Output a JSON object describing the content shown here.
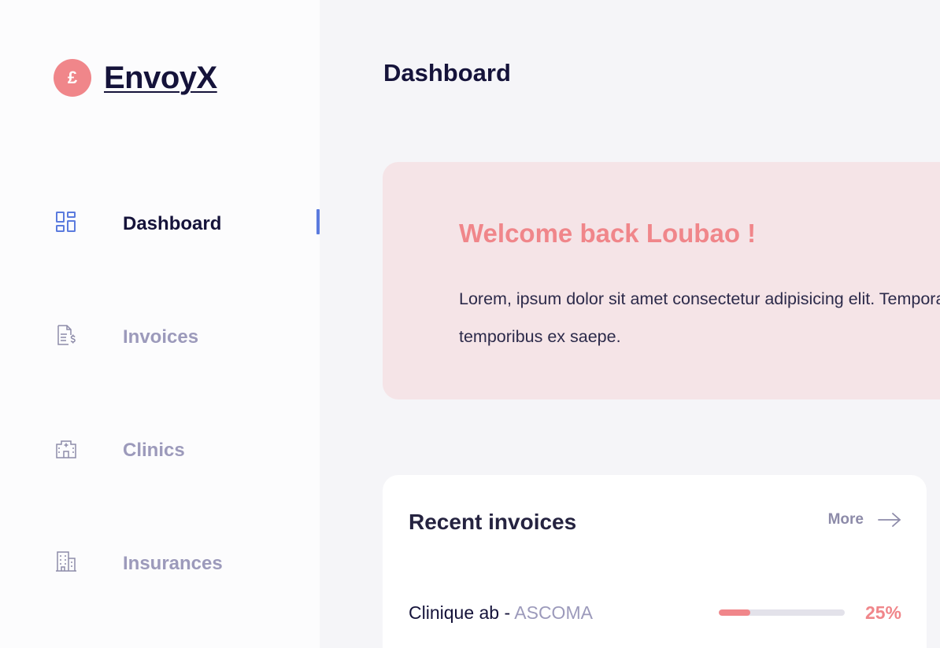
{
  "brand": {
    "logo_symbol": "£",
    "name": "EnvoyX"
  },
  "colors": {
    "accent": "#f0868a",
    "active_indicator": "#5b7bde",
    "text_dark": "#15133a",
    "text_muted": "#9c9abb"
  },
  "sidebar": {
    "items": [
      {
        "label": "Dashboard",
        "icon": "dashboard-grid-icon",
        "active": true
      },
      {
        "label": "Invoices",
        "icon": "invoice-dollar-icon",
        "active": false
      },
      {
        "label": "Clinics",
        "icon": "hospital-icon",
        "active": false
      },
      {
        "label": "Insurances",
        "icon": "building-icon",
        "active": false
      }
    ]
  },
  "header": {
    "title": "Dashboard"
  },
  "welcome": {
    "title": "Welcome back Loubao !",
    "text": "Lorem, ipsum dolor sit amet consectetur adipisicing elit. Tempora temporibus ex saepe."
  },
  "recent_invoices": {
    "title": "Recent invoices",
    "more_label": "More",
    "rows": [
      {
        "clinic": "Clinique ab",
        "separator": " - ",
        "insurer": "ASCOMA",
        "progress": 0.25,
        "percent_label": "25%"
      }
    ]
  }
}
